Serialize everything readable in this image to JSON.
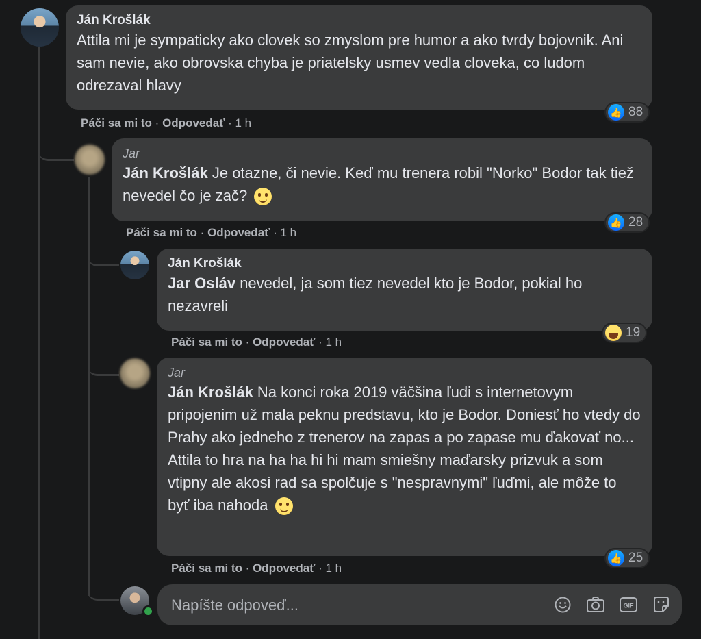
{
  "comments": [
    {
      "author": "Ján Krošlák",
      "text": "Attila mi je sympaticky ako clovek so zmyslom pre humor a ako tvrdy bojovnik. Ani sam nevie, ako obrovska chyba je priatelsky usmev vedla cloveka, co ludom odrezaval hlavy",
      "reaction_count": "88",
      "like_label": "Páči sa mi to",
      "reply_label": "Odpovedať",
      "time": "1 h"
    },
    {
      "author": "Jar",
      "mention": "Ján Krošlák",
      "text": " Je otazne, či nevie. Keď mu trenera robil \"Norko\" Bodor tak tiež nevedel čo je zač?",
      "reaction_count": "28",
      "like_label": "Páči sa mi to",
      "reply_label": "Odpovedať",
      "time": "1 h"
    },
    {
      "author": "Ján Krošlák",
      "mention": "Jar Osláv",
      "text": " nevedel, ja som tiez nevedel kto je Bodor, pokial ho nezavreli",
      "reaction_count": "19",
      "like_label": "Páči sa mi to",
      "reply_label": "Odpovedať",
      "time": "1 h"
    },
    {
      "author": "Jar",
      "mention": "Ján Krošlák",
      "text": " Na konci roka 2019 väčšina ľudi s internetovym pripojenim už mala peknu predstavu, kto je Bodor. Doniesť ho vtedy do Prahy ako jedneho z trenerov na zapas a po zapase mu ďakovať no... Attila to hra na ha ha hi hi mam smiešny maďarsky prizvuk a som vtipny ale akosi rad sa spolčuje s \"nespravnymi\" ľuďmi, ale môže to byť iba nahoda",
      "reaction_count": "25",
      "like_label": "Páči sa mi to",
      "reply_label": "Odpovedať",
      "time": "1 h"
    }
  ],
  "composer": {
    "placeholder": "Napíšte odpoveď..."
  },
  "sep": "·"
}
